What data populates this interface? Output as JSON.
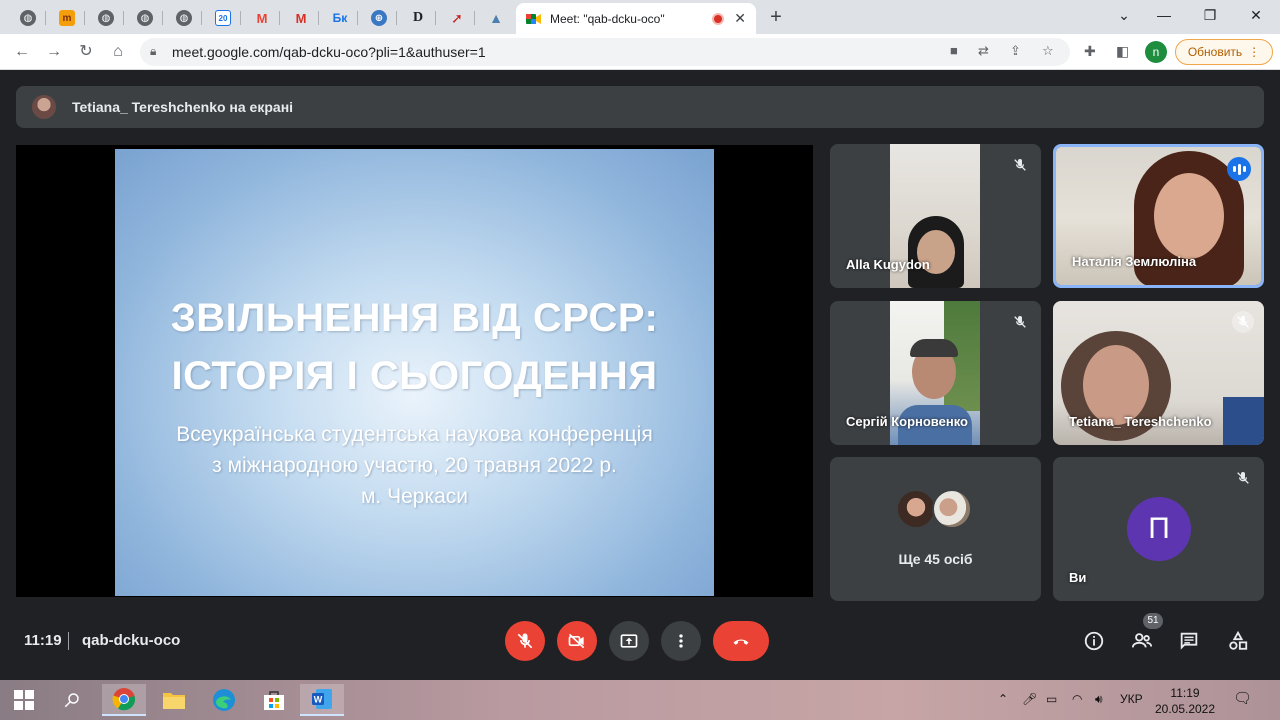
{
  "browser": {
    "tabs": [
      {
        "icon": "globe-icon"
      },
      {
        "icon": "moodle-icon",
        "label": "m"
      },
      {
        "icon": "globe-icon"
      },
      {
        "icon": "globe-icon"
      },
      {
        "icon": "globe-icon"
      },
      {
        "icon": "calendar-icon",
        "label": "20"
      },
      {
        "icon": "gmail-icon",
        "label": "M"
      },
      {
        "icon": "gmail-icon",
        "label": "M"
      },
      {
        "icon": "bk-icon",
        "label": "Бк"
      },
      {
        "icon": "web-icon"
      },
      {
        "icon": "d-icon",
        "label": "D"
      },
      {
        "icon": "arrow-icon"
      },
      {
        "icon": "drive-icon"
      }
    ],
    "active_tab_title": "Meet: \"qab-dcku-oco\"",
    "url": "meet.google.com/qab-dcku-oco?pli=1&authuser=1",
    "profile_letter": "n",
    "update_label": "Обновить"
  },
  "meet": {
    "presenting_text": "Tetiana_ Tereshchenko на екрані",
    "slide": {
      "title_line1": "ЗВІЛЬНЕННЯ ВІД СРСР:",
      "title_line2": "ІСТОРІЯ І СЬОГОДЕННЯ",
      "sub_line1": "Всеукраїнська студентська наукова конференція",
      "sub_line2": "з міжнародною участю, 20 травня 2022 р.",
      "sub_line3": "м. Черкаси"
    },
    "participants": [
      {
        "name": "Alla Kugydon",
        "muted": true
      },
      {
        "name": "Наталія Землюліна",
        "speaking": true
      },
      {
        "name": "Сергій Корновенко",
        "muted": true
      },
      {
        "name": "Tetiana_ Tereshchenko",
        "muted": true
      },
      {
        "name": "Ви",
        "avatar_letter": "П",
        "muted": true
      }
    ],
    "more_people_label": "Ще 45 осіб",
    "time": "11:19",
    "meeting_code": "qab-dcku-oco",
    "participant_count": "51"
  },
  "taskbar": {
    "language": "УКР",
    "time": "11:19",
    "date": "20.05.2022"
  },
  "colors": {
    "meet_bg": "#202124",
    "tile_bg": "#3c4043",
    "danger": "#ea4335",
    "speaking": "#1a73e8",
    "self_avatar": "#5e35b1"
  }
}
